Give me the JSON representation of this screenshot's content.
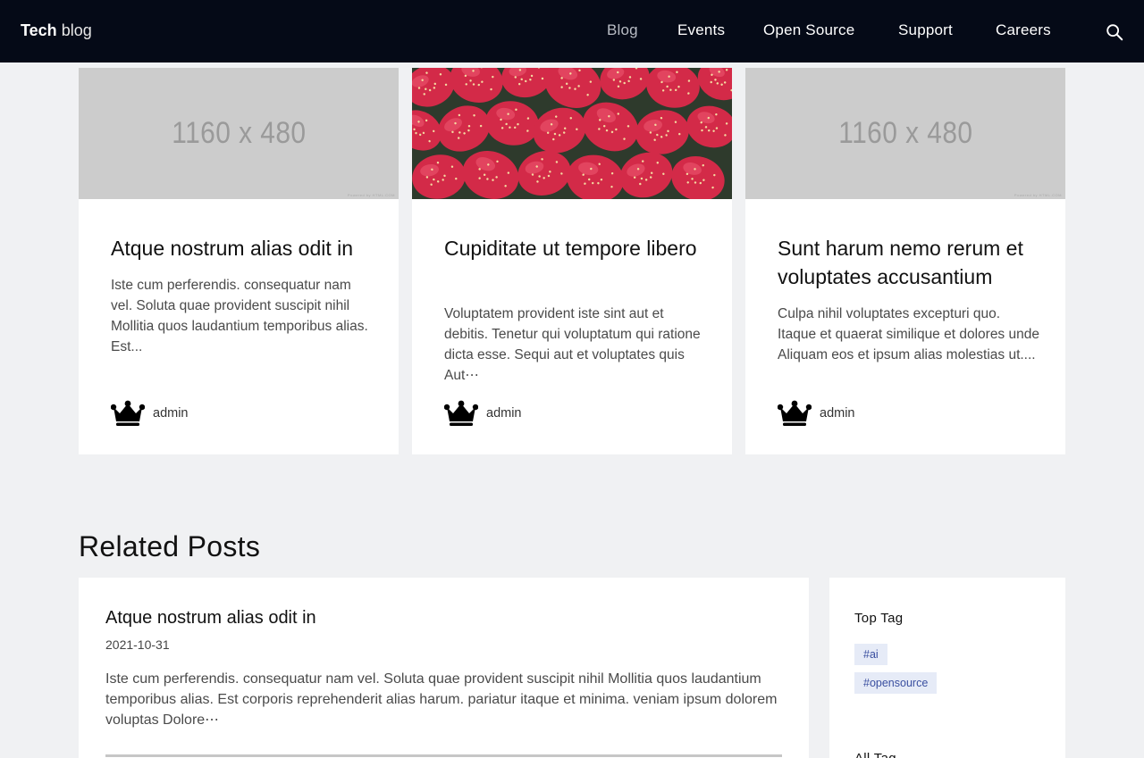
{
  "header": {
    "logo_bold": "Tech",
    "logo_rest": "blog",
    "nav": [
      "Blog",
      "Events",
      "Open Source",
      "Support",
      "Careers"
    ]
  },
  "cards": [
    {
      "image_text": "1160 x 480",
      "title": "Atque nostrum alias odit in",
      "excerpt": "Iste cum perferendis. consequatur nam vel. Soluta quae provident suscipit nihil Mollitia quos laudantium temporibus alias. Est...",
      "author": "admin"
    },
    {
      "image_text": "",
      "title": "Cupiditate ut tempore libero",
      "excerpt": "Voluptatem provident iste sint aut et debitis. Tenetur qui voluptatum qui ratione dicta esse. Sequi aut et voluptates quis Aut⋯",
      "author": "admin"
    },
    {
      "image_text": "1160 x 480",
      "title": "Sunt harum nemo rerum et voluptates accusantium",
      "excerpt": "Culpa nihil voluptates excepturi quo. Itaque et quaerat similique et dolores unde Aliquam eos et ipsum alias molestias ut....",
      "author": "admin"
    }
  ],
  "related": {
    "heading": "Related Posts",
    "post": {
      "title": "Atque nostrum alias odit in",
      "date": "2021-10-31",
      "excerpt": "Iste cum perferendis. consequatur nam vel. Soluta quae provident suscipit nihil Mollitia quos laudantium temporibus alias. Est corporis reprehenderit alias harum. pariatur itaque et minima. veniam ipsum dolorem voluptas Dolore⋯"
    }
  },
  "sidebar": {
    "top_tag_label": "Top Tag",
    "tags": [
      "#ai",
      "#opensource"
    ],
    "all_tag_label": "All Tag"
  },
  "colors": {
    "navbar_bg": "#050a17",
    "page_bg": "#f0f1f3",
    "tag_bg": "#e6ebf7",
    "tag_text": "#3a4fa0"
  }
}
